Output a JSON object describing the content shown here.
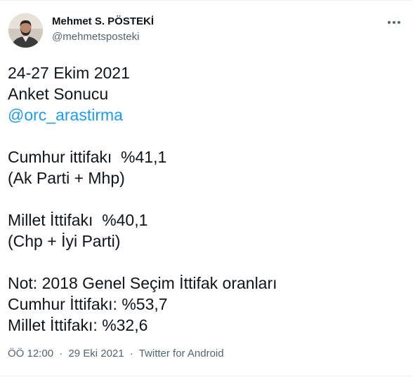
{
  "author": {
    "display_name": "Mehmet S. PÖSTEKİ",
    "handle": "@mehmetsposteki"
  },
  "tweet": {
    "lines": [
      "24-27 Ekim 2021",
      "Anket Sonucu",
      "@orc_arastirma",
      "",
      "Cumhur ittifakı  %41,1",
      "(Ak Parti + Mhp)",
      "",
      "Millet İttifakı  %40,1",
      "(Chp + İyi Parti)",
      "",
      "Not: 2018 Genel Seçim İttifak oranları",
      "Cumhur İttifakı: %53,7",
      "Millet İttifakı: %32,6"
    ]
  },
  "meta": {
    "time": "ÖÖ 12:00",
    "date": "29 Eki 2021",
    "source": "Twitter for Android",
    "separator": "·"
  },
  "colors": {
    "text": "#0f1419",
    "secondary": "#536471",
    "link": "#1d9bf0",
    "border": "#eff3f4"
  },
  "icons": {
    "more": "more-horizontal-icon"
  }
}
